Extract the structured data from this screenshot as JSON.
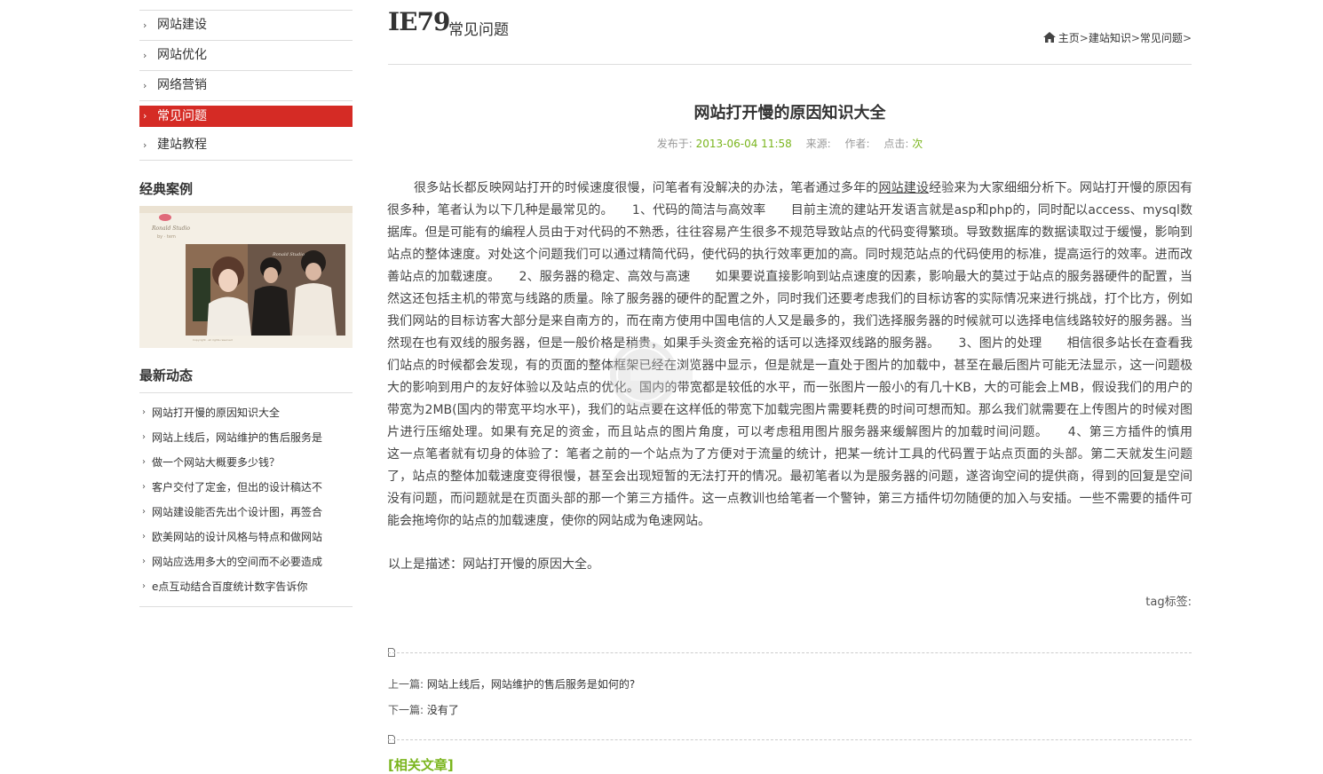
{
  "sidebar": {
    "nav": [
      {
        "label": "网站建设",
        "active": false
      },
      {
        "label": "网站优化",
        "active": false
      },
      {
        "label": "网络营销",
        "active": false
      },
      {
        "label": "常见问题",
        "active": true
      },
      {
        "label": "建站教程",
        "active": false
      }
    ],
    "cases_title": "经典案例",
    "news_title": "最新动态",
    "news": [
      "网站打开慢的原因知识大全",
      "网站上线后，网站维护的售后服务是",
      "做一个网站大概要多少钱？",
      "客户交付了定金，但出的设计稿达不",
      "网站建设能否先出个设计图，再签合",
      "欧美网站的设计风格与特点和做网站",
      "网站应选用多大的空间而不必要造成",
      "e点互动结合百度统计数字告诉你"
    ]
  },
  "header": {
    "logo": "IE79",
    "section": "常见问题",
    "breadcrumb": [
      "主页",
      "建站知识",
      "常见问题"
    ],
    "breadcrumb_sep": ">"
  },
  "article": {
    "title": "网站打开慢的原因知识大全",
    "meta": {
      "published_label": "发布于:",
      "published_value": "2013-06-04 11:58",
      "source_label": "来源:",
      "author_label": "作者:",
      "clicks_label": "点击:",
      "clicks_suffix": "次"
    },
    "body_pre": "很多站长都反映网站打开的时候速度很慢，问笔者有没解决的办法，笔者通过多年的",
    "body_link": "网站建设",
    "body_post": "经验来为大家细细分析下。网站打开慢的原因有很多种，笔者认为以下几种是最常见的。　　1、代码的简洁与高效率　　目前主流的建站开发语言就是asp和php的，同时配以access、mysql数据库。但是可能有的编程人员由于对代码的不熟悉，往往容易产生很多不规范导致站点的代码变得繁琐。导致数据库的数据读取过于缓慢，影响到站点的整体速度。对处这个问题我们可以通过精简代码，使代码的执行效率更加的高。同时规范站点的代码使用的标准，提高运行的效率。进而改善站点的加载速度。　　2、服务器的稳定、高效与高速　　如果要说直接影响到站点速度的因素，影响最大的莫过于站点的服务器硬件的配置，当然这还包括主机的带宽与线路的质量。除了服务器的硬件的配置之外，同时我们还要考虑我们的目标访客的实际情况来进行挑战，打个比方，例如我们网站的目标访客大部分是来自南方的，而在南方使用中国电信的人又是最多的，我们选择服务器的时候就可以选择电信线路较好的服务器。当然现在也有双线的服务器，但是一般价格是稍贵，如果手头资金充裕的话可以选择双线路的服务器。　　3、图片的处理　　相信很多站长在查看我们站点的时候都会发现，有的页面的整体框架已经在浏览器中显示，但是就是一直处于图片的加载中，甚至在最后图片可能无法显示，这一问题极大的影响到用户的友好体验以及站点的优化。国内的带宽都是较低的水平，而一张图片一般小的有几十KB，大的可能会上MB，假设我们的用户的带宽为2MB(国内的带宽平均水平)，我们的站点要在这样低的带宽下加载完图片需要耗费的时间可想而知。那么我们就需要在上传图片的时候对图片进行压缩处理。如果有充足的资金，而且站点的图片角度，可以考虑租用图片服务器来缓解图片的加载时间问题。　　4、第三方插件的慎用　　这一点笔者就有切身的体验了：笔者之前的一个站点为了方便对于流量的统计，把某一统计工具的代码置于站点页面的头部。第二天就发生问题了，站点的整体加载速度变得很慢，甚至会出现短暂的无法打开的情况。最初笔者以为是服务器的问题，遂咨询空间的提供商，得到的回复是空间没有问题，而问题就是在页面头部的那一个第三方插件。这一点教训也给笔者一个警钟，第三方插件切勿随便的加入与安插。一些不需要的插件可能会拖垮你的站点的加载速度，使你的网站成为龟速网站。",
    "summary": "以上是描述：网站打开慢的原因大全。",
    "tags_label": "tag标签:",
    "prev_label": "上一篇:",
    "prev_value": "网站上线后，网站维护的售后服务是如何的?",
    "next_label": "下一篇:",
    "next_value": "没有了",
    "related_label": "[相关文章]"
  },
  "colors": {
    "accent_red": "#d52b25",
    "accent_green": "#7ab51d"
  },
  "icons": [
    "home-icon",
    "chevron-right-icon",
    "document-icon"
  ]
}
